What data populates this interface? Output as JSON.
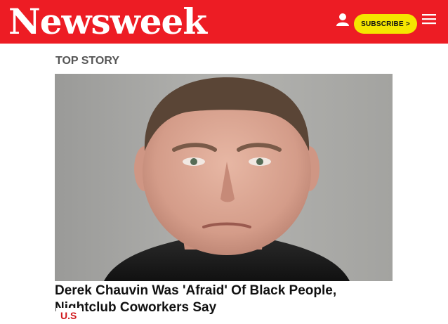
{
  "header": {
    "logo_text": "Newsweek",
    "subscribe_label": "SUBSCRIBE >",
    "brand_color": "#ed1c24",
    "subscribe_color": "#f5e600",
    "icons": [
      "user-icon",
      "hamburger-menu-icon"
    ]
  },
  "main": {
    "section_label": "TOP STORY",
    "hero_image": "mugshot-photo",
    "headline": "Derek Chauvin Was 'Afraid' Of Black People, Nightclub Coworkers Say",
    "category_tag": "U.S",
    "tag_color": "#d0181c"
  }
}
